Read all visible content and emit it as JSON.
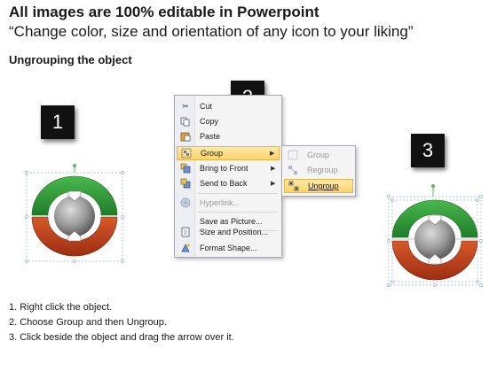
{
  "header": {
    "title": "All images are 100% editable in Powerpoint",
    "subtitle": "“Change color, size and orientation of any icon to your liking”"
  },
  "section_title": "Ungrouping the object",
  "step_badges": [
    "1",
    "2",
    "3"
  ],
  "context_menu": {
    "items": [
      {
        "label": "Cut",
        "icon": "scissors-icon"
      },
      {
        "label": "Copy",
        "icon": "copy-icon"
      },
      {
        "label": "Paste",
        "icon": "paste-icon"
      },
      {
        "label": "Group",
        "icon": "group-icon",
        "highlighted": true,
        "submenu": true
      },
      {
        "label": "Bring to Front",
        "icon": "bring-to-front-icon",
        "submenu": true
      },
      {
        "label": "Send to Back",
        "icon": "send-to-back-icon",
        "submenu": true
      },
      {
        "label": "Hyperlink...",
        "icon": "hyperlink-icon",
        "disabled": true
      },
      {
        "label": "Save as Picture...",
        "icon": ""
      },
      {
        "label": "Size and Position...",
        "icon": "size-position-icon"
      },
      {
        "label": "Format Shape...",
        "icon": "format-shape-icon"
      }
    ]
  },
  "submenu": {
    "items": [
      {
        "label": "Group",
        "disabled": true
      },
      {
        "label": "Regroup",
        "disabled": true
      },
      {
        "label": "Ungroup",
        "highlighted": true
      }
    ]
  },
  "instructions": [
    "1.  Right click the object.",
    "2.  Choose Group and then Ungroup.",
    "3.  Click beside the object and drag the arrow over it."
  ],
  "colors": {
    "green": "#2e9a3a",
    "red": "#c0401c",
    "gray_sphere": "#8c8c8c",
    "menu_highlight": "#fbd46a"
  }
}
